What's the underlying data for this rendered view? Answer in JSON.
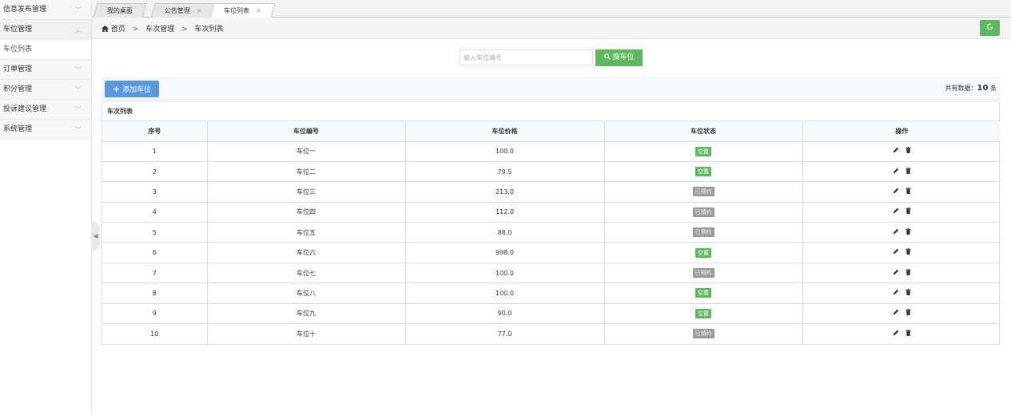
{
  "sidebar": {
    "items": [
      {
        "label": "信息发布管理",
        "chevron": "﹀"
      },
      {
        "label": "车位管理",
        "chevron": "︿"
      },
      {
        "label": "车位列表"
      },
      {
        "label": "订单管理",
        "chevron": "﹀"
      },
      {
        "label": "积分管理",
        "chevron": "﹀"
      },
      {
        "label": "投诉建议管理",
        "chevron": "﹀"
      },
      {
        "label": "系统管理",
        "chevron": "﹀"
      }
    ]
  },
  "tabs": [
    {
      "label": "我的桌面"
    },
    {
      "label": "公告管理",
      "close": "×"
    },
    {
      "label": "车位列表",
      "close": "×"
    }
  ],
  "breadcrumb": {
    "home": "首页",
    "sep": ">",
    "level1": "车次管理",
    "level2": "车次列表"
  },
  "search": {
    "placeholder": "输入车位编号",
    "button_label": "搜车位"
  },
  "toolbar": {
    "add_label": "添加车位",
    "total_prefix": "共有数据：",
    "total_count": "10",
    "total_suffix": " 条"
  },
  "table": {
    "caption": "车次列表",
    "headers": [
      "序号",
      "车位编号",
      "车位价格",
      "车位状态",
      "操作"
    ],
    "rows": [
      {
        "no": "1",
        "code": "车位一",
        "price": "100.0",
        "status": "空置",
        "status_type": "free"
      },
      {
        "no": "2",
        "code": "车位二",
        "price": "79.5",
        "status": "空置",
        "status_type": "free"
      },
      {
        "no": "3",
        "code": "车位三",
        "price": "213.0",
        "status": "已预约",
        "status_type": "booked"
      },
      {
        "no": "4",
        "code": "车位四",
        "price": "112.0",
        "status": "已预约",
        "status_type": "booked"
      },
      {
        "no": "5",
        "code": "车位五",
        "price": "88.0",
        "status": "已预约",
        "status_type": "booked"
      },
      {
        "no": "6",
        "code": "车位六",
        "price": "998.0",
        "status": "空置",
        "status_type": "free"
      },
      {
        "no": "7",
        "code": "车位七",
        "price": "100.0",
        "status": "已预约",
        "status_type": "booked"
      },
      {
        "no": "8",
        "code": "车位八",
        "price": "100.0",
        "status": "空置",
        "status_type": "free"
      },
      {
        "no": "9",
        "code": "车位九",
        "price": "90.0",
        "status": "空置",
        "status_type": "free"
      },
      {
        "no": "10",
        "code": "车位十",
        "price": "77.0",
        "status": "已预约",
        "status_type": "booked"
      }
    ]
  },
  "colors": {
    "green": "#5eb95e",
    "blue": "#5a98de",
    "gray_badge": "#999999"
  },
  "icons": {
    "home": "home-icon",
    "search": "search-icon",
    "plus": "plus-icon",
    "refresh": "refresh-icon",
    "edit": "pencil-icon",
    "delete": "trash-icon",
    "collapse": "caret-left-icon"
  }
}
